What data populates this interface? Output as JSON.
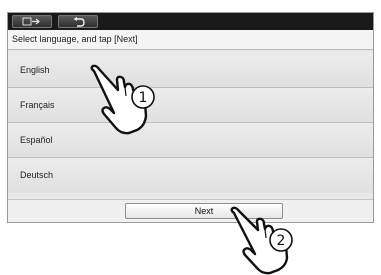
{
  "topbar": {
    "buttons": [
      {
        "icon": "back-menu-icon"
      },
      {
        "icon": "return-icon"
      }
    ]
  },
  "instruction": "Select language, and tap [Next]",
  "languages": [
    "English",
    "Français",
    "Español",
    "Deutsch"
  ],
  "next_label": "Next",
  "callouts": [
    {
      "number": "①",
      "icon": "tap-hand-icon"
    },
    {
      "number": "②",
      "icon": "tap-hand-icon"
    }
  ]
}
